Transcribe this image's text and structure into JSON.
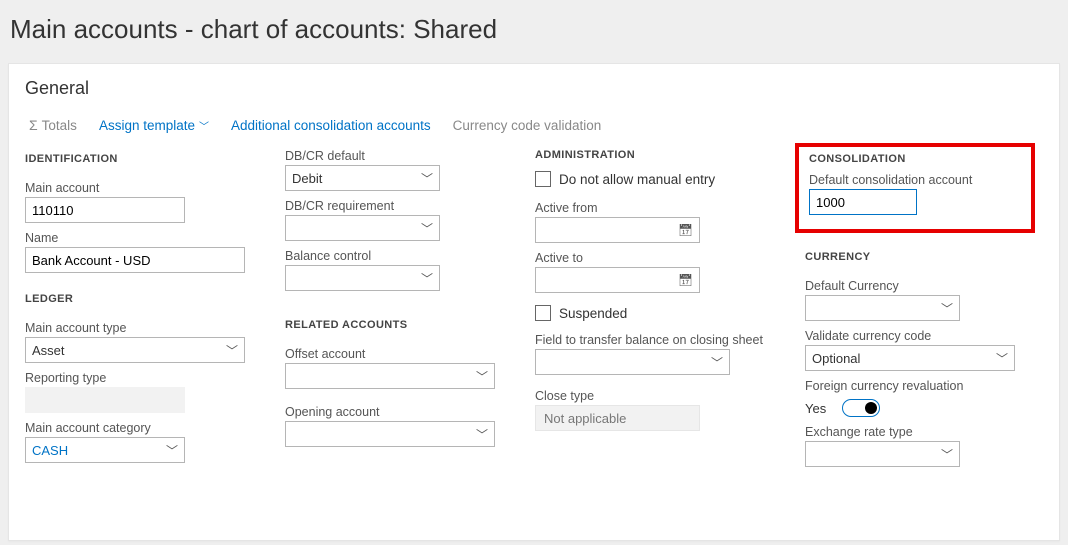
{
  "page_title": "Main accounts - chart of accounts: Shared",
  "panel_heading": "General",
  "toolbar": {
    "totals": "Totals",
    "assign_template": "Assign template",
    "additional_consolidation": "Additional consolidation accounts",
    "currency_code_validation": "Currency code validation"
  },
  "identification": {
    "section": "IDENTIFICATION",
    "main_account_label": "Main account",
    "main_account_value": "110110",
    "name_label": "Name",
    "name_value": "Bank Account - USD"
  },
  "ledger": {
    "section": "LEDGER",
    "main_account_type_label": "Main account type",
    "main_account_type_value": "Asset",
    "reporting_type_label": "Reporting type",
    "main_account_category_label": "Main account category",
    "main_account_category_value": "CASH"
  },
  "dbcr": {
    "default_label": "DB/CR default",
    "default_value": "Debit",
    "requirement_label": "DB/CR requirement",
    "requirement_value": "",
    "balance_control_label": "Balance control",
    "balance_control_value": ""
  },
  "related": {
    "section": "RELATED ACCOUNTS",
    "offset_label": "Offset account",
    "offset_value": "",
    "opening_label": "Opening account",
    "opening_value": ""
  },
  "administration": {
    "section": "ADMINISTRATION",
    "do_not_allow_label": "Do not allow manual entry",
    "active_from_label": "Active from",
    "active_to_label": "Active to",
    "suspended_label": "Suspended",
    "transfer_label": "Field to transfer balance on closing sheet",
    "transfer_value": "",
    "close_type_label": "Close type",
    "close_type_value": "Not applicable"
  },
  "consolidation": {
    "section": "CONSOLIDATION",
    "default_account_label": "Default consolidation account",
    "default_account_value": "1000"
  },
  "currency": {
    "section": "CURRENCY",
    "default_currency_label": "Default Currency",
    "default_currency_value": "",
    "validate_label": "Validate currency code",
    "validate_value": "Optional",
    "foreign_reval_label": "Foreign currency revaluation",
    "foreign_reval_value": "Yes",
    "exchange_rate_label": "Exchange rate type",
    "exchange_rate_value": ""
  }
}
